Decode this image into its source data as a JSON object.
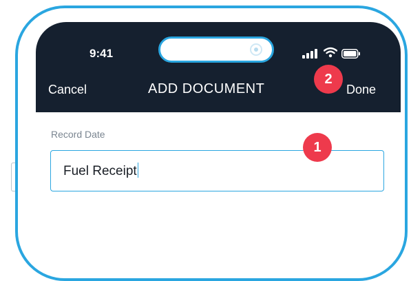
{
  "status_bar": {
    "time": "9:41",
    "icons": [
      "camera-icon",
      "signal-icon",
      "wifi-icon",
      "battery-icon"
    ]
  },
  "nav": {
    "cancel_label": "Cancel",
    "title": "ADD DOCUMENT",
    "done_label": "Done"
  },
  "form": {
    "field_label": "Record Date",
    "field_value": "Fuel Receipt"
  },
  "annotations": {
    "badge_1": "1",
    "badge_2": "2"
  },
  "colors": {
    "accent": "#2aa6e0",
    "nav_background": "#15202f",
    "badge": "#ee3a4c"
  }
}
